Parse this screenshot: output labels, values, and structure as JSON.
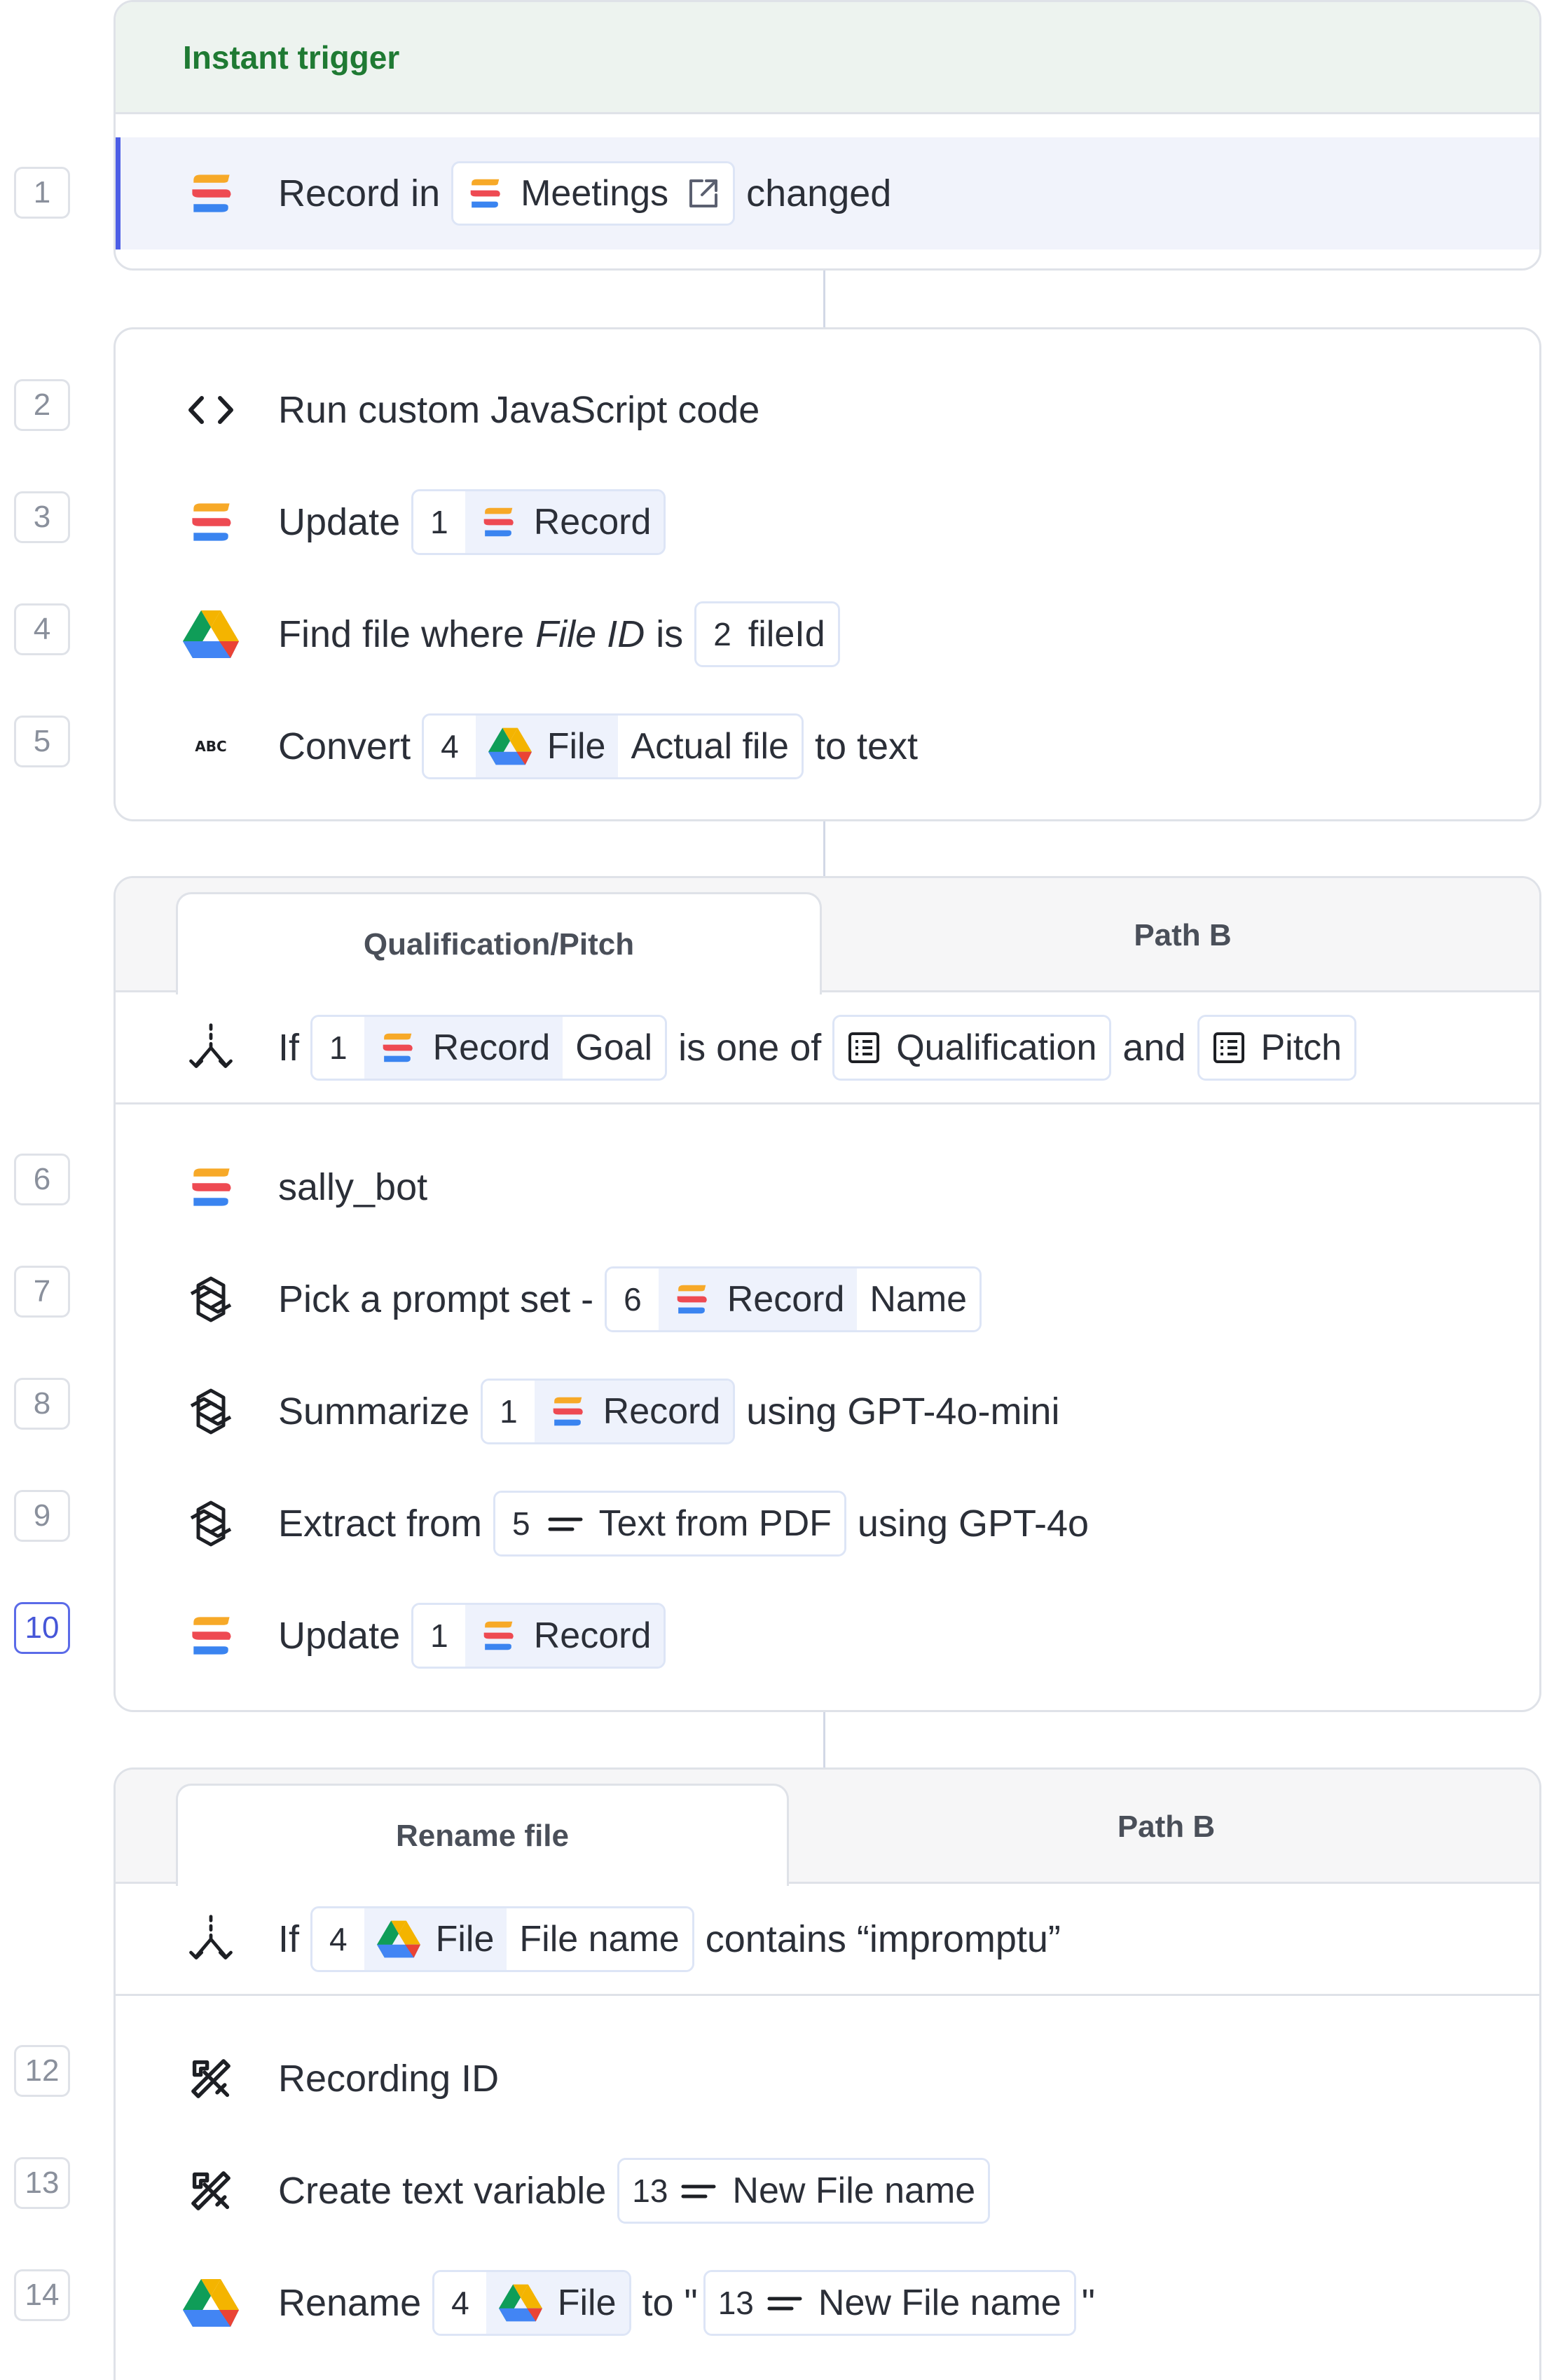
{
  "trigger": {
    "header": "Instant trigger",
    "step_number": "1",
    "prefix": "Record in",
    "pill_label": "Meetings",
    "suffix": "changed"
  },
  "block1": {
    "steps": [
      {
        "number": "2",
        "text": "Run custom JavaScript code"
      },
      {
        "number": "3",
        "verb": "Update",
        "ref_num": "1",
        "ref_label": "Record"
      },
      {
        "number": "4",
        "pre": "Find file where",
        "field": "File ID",
        "mid": "is",
        "ref_num": "2",
        "ref_label": "fileId"
      },
      {
        "number": "5",
        "verb": "Convert",
        "ref_num": "4",
        "ref_label": "File",
        "ref_field": "Actual file",
        "post": "to text"
      }
    ]
  },
  "block2": {
    "tabs": [
      "Qualification/Pitch",
      "Path B"
    ],
    "condition": {
      "if": "If",
      "ref_num": "1",
      "ref_label": "Record",
      "ref_field": "Goal",
      "op": "is one of",
      "opt1": "Qualification",
      "and": "and",
      "opt2": "Pitch"
    },
    "steps": [
      {
        "number": "6",
        "text": "sally_bot"
      },
      {
        "number": "7",
        "pre": "Pick a prompt set -",
        "ref_num": "6",
        "ref_label": "Record",
        "ref_field": "Name"
      },
      {
        "number": "8",
        "pre": "Summarize",
        "ref_num": "1",
        "ref_label": "Record",
        "post": "using GPT-4o-mini"
      },
      {
        "number": "9",
        "pre": "Extract from",
        "ref_num": "5",
        "ref_label": "Text from PDF",
        "post": "using GPT-4o"
      },
      {
        "number": "10",
        "pre": "Update",
        "ref_num": "1",
        "ref_label": "Record"
      }
    ]
  },
  "block3": {
    "tabs": [
      "Rename file",
      "Path B"
    ],
    "condition": {
      "if": "If",
      "ref_num": "4",
      "ref_label": "File",
      "ref_field": "File name",
      "op": "contains “impromptu”"
    },
    "steps": [
      {
        "number": "12",
        "text": "Recording ID"
      },
      {
        "number": "13",
        "pre": "Create text variable",
        "ref_num": "13",
        "ref_label": "New File name"
      },
      {
        "number": "14",
        "pre": "Rename",
        "ref_num": "4",
        "ref_label": "File",
        "mid": "to \"",
        "ref2_num": "13",
        "ref2_label": "New File name",
        "post": "\""
      }
    ]
  },
  "colors": {
    "trigger_text": "#1f7a33",
    "active_border": "#4c5ee6",
    "pill_tint": "#eef2fc"
  },
  "icons": [
    "sally-logo-icon",
    "code-brackets-icon",
    "google-drive-icon",
    "text-abc-icon",
    "branch-split-icon",
    "openai-icon",
    "variable-tool-icon",
    "external-link-icon",
    "list-option-icon",
    "text-lines-icon"
  ]
}
